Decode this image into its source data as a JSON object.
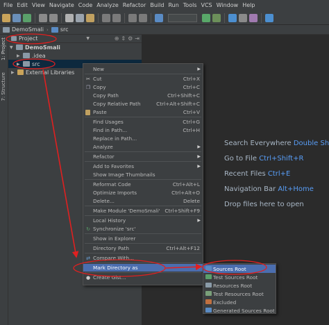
{
  "menubar": [
    "File",
    "Edit",
    "View",
    "Navigate",
    "Code",
    "Analyze",
    "Refactor",
    "Build",
    "Run",
    "Tools",
    "VCS",
    "Window",
    "Help"
  ],
  "breadcrumb": {
    "project": "DemoSmali",
    "folder": "src"
  },
  "sidestrip": {
    "project_tab": "1: Project",
    "structure_tab": "7: Structure"
  },
  "project_pane": {
    "title": "Project",
    "tree": {
      "root": "DemoSmali",
      "idea": ".idea",
      "src": "src",
      "external": "External Libraries"
    }
  },
  "editor_hints": [
    {
      "label": "Search Everywhere",
      "key": "Double Shift"
    },
    {
      "label": "Go to File",
      "key": "Ctrl+Shift+R"
    },
    {
      "label": "Recent Files",
      "key": "Ctrl+E"
    },
    {
      "label": "Navigation Bar",
      "key": "Alt+Home"
    },
    {
      "label": "Drop files here to open",
      "key": ""
    }
  ],
  "context_menu": {
    "new": "New",
    "cut": "Cut",
    "cut_sc": "Ctrl+X",
    "copy": "Copy",
    "copy_sc": "Ctrl+C",
    "copy_path": "Copy Path",
    "copy_path_sc": "Ctrl+Shift+C",
    "copy_rel": "Copy Relative Path",
    "copy_rel_sc": "Ctrl+Alt+Shift+C",
    "paste": "Paste",
    "paste_sc": "Ctrl+V",
    "find_usages": "Find Usages",
    "find_usages_sc": "Ctrl+G",
    "find_in_path": "Find in Path...",
    "find_in_path_sc": "Ctrl+H",
    "replace_in_path": "Replace in Path...",
    "analyze": "Analyze",
    "refactor": "Refactor",
    "add_fav": "Add to Favorites",
    "show_thumbs": "Show Image Thumbnails",
    "reformat": "Reformat Code",
    "reformat_sc": "Ctrl+Alt+L",
    "optimize": "Optimize Imports",
    "optimize_sc": "Ctrl+Alt+O",
    "delete": "Delete...",
    "delete_sc": "Delete",
    "make_module": "Make Module 'DemoSmali'",
    "make_module_sc": "Ctrl+Shift+F9",
    "local_history": "Local History",
    "synchronize": "Synchronize 'src'",
    "show_explorer": "Show in Explorer",
    "dir_path": "Directory Path",
    "dir_path_sc": "Ctrl+Alt+F12",
    "compare": "Compare With...",
    "mark_dir": "Mark Directory as",
    "create_gist": "Create Gist..."
  },
  "submenu": {
    "sources_root": "Sources Root",
    "test_sources_root": "Test Sources Root",
    "resources_root": "Resources Root",
    "test_resources_root": "Test Resources Root",
    "excluded": "Excluded",
    "generated_sources_root": "Generated Sources Root"
  },
  "colors": {
    "annotation_red": "#e02020",
    "highlight": "#4b6eaf",
    "key_blue": "#589df6"
  }
}
